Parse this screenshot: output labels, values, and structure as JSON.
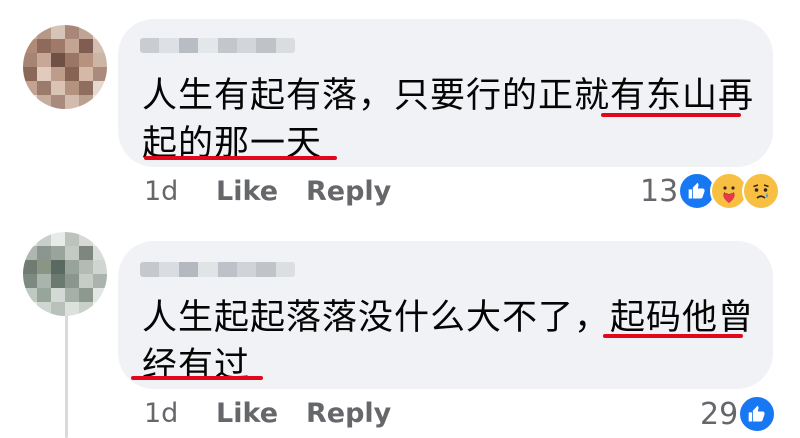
{
  "comments": [
    {
      "text_line1": "人生有起有落，只要行的正就有东山再",
      "text_line2": "起的那一天",
      "time": "1d",
      "like_label": "Like",
      "reply_label": "Reply",
      "reaction_count": "13",
      "reactions": [
        "like-icon",
        "care-icon",
        "sad-icon"
      ]
    },
    {
      "text_line1": "人生起起落落没什么大不了，起码他曾",
      "text_line2": "经有过",
      "time": "1d",
      "like_label": "Like",
      "reply_label": "Reply",
      "reaction_count": "29",
      "reactions": [
        "like-icon"
      ]
    }
  ],
  "colors": {
    "bubble": "#f0f2f5",
    "underline": "#e0081a",
    "like_blue": "#1877f2",
    "meta_gray": "#65676b"
  }
}
